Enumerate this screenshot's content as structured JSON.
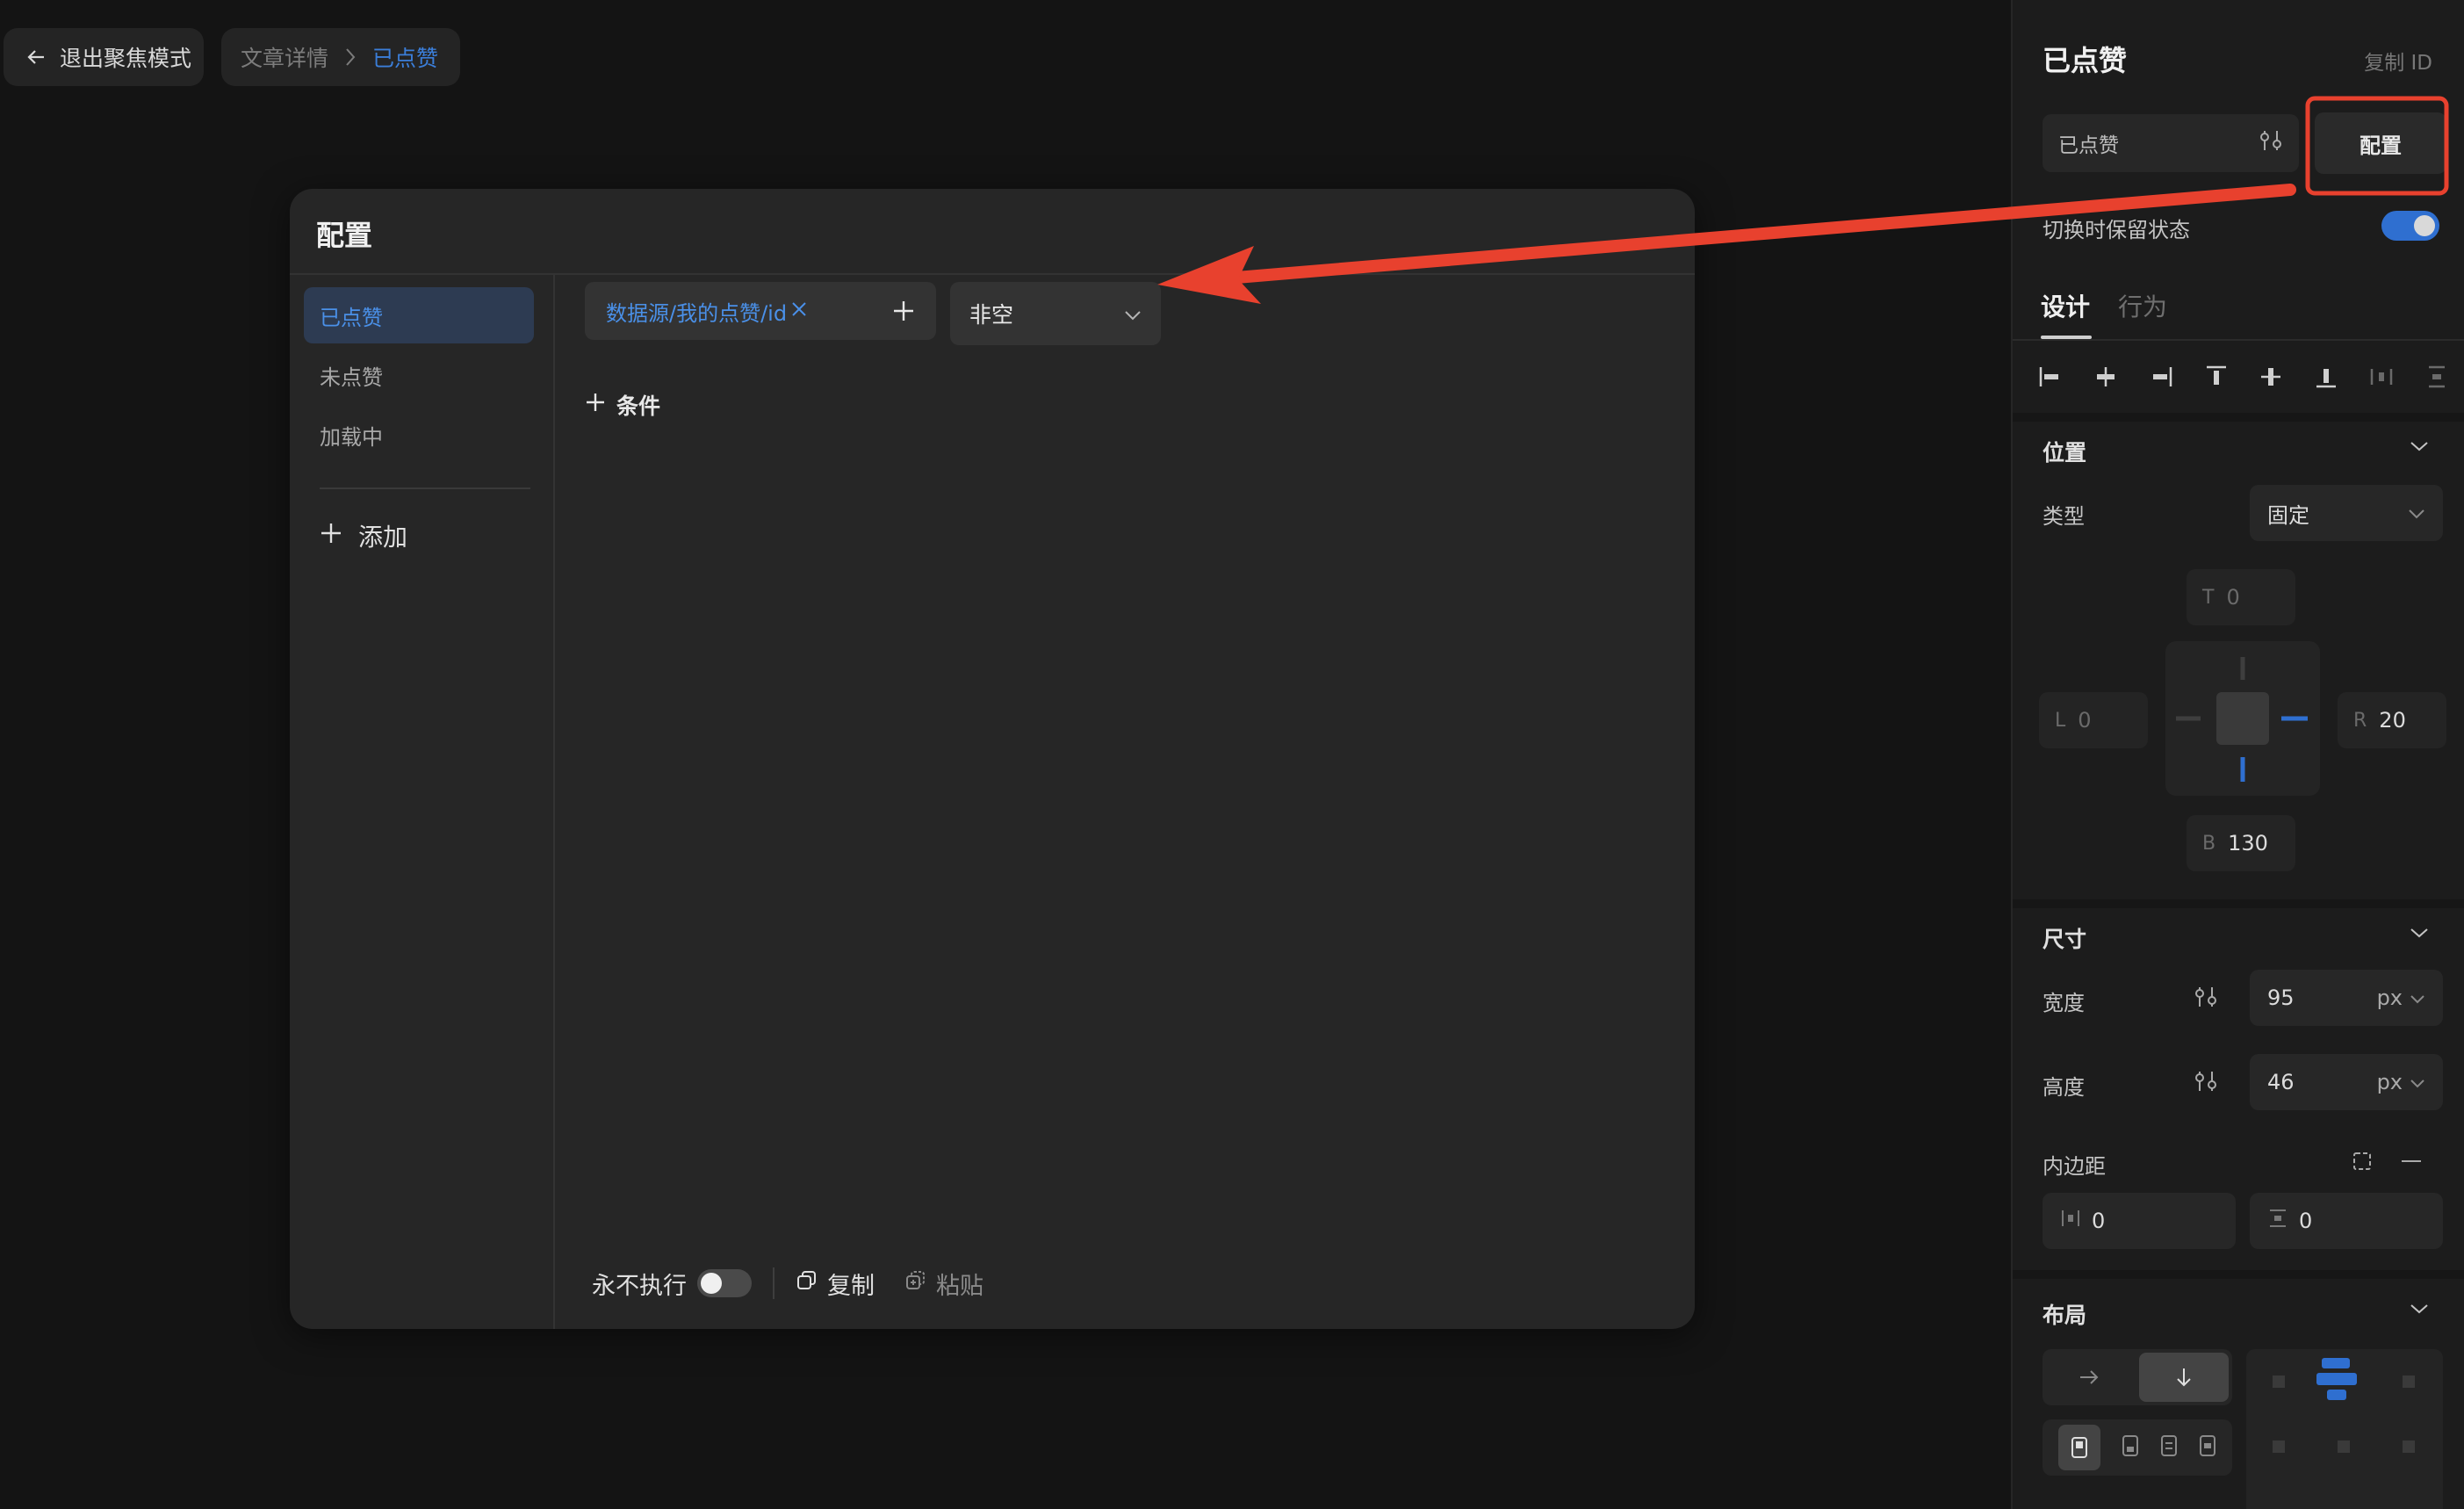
{
  "topbar": {
    "exit_focus_label": "退出聚焦模式",
    "breadcrumb_parent": "文章详情",
    "breadcrumb_current": "已点赞"
  },
  "modal": {
    "title": "配置",
    "states": [
      {
        "label": "已点赞",
        "active": true
      },
      {
        "label": "未点赞",
        "active": false
      },
      {
        "label": "加载中",
        "active": false
      }
    ],
    "add_label": "添加",
    "condition": {
      "field_value": "数据源/我的点赞/id",
      "operator": "非空"
    },
    "add_condition_label": "条件",
    "footer": {
      "never_execute_label": "永不执行",
      "copy_label": "复制",
      "paste_label": "粘贴"
    }
  },
  "panel": {
    "title": "已点赞",
    "copy_id_label": "复制 ID",
    "state_select_value": "已点赞",
    "config_button_label": "配置",
    "keep_state_label": "切换时保留状态",
    "tabs": {
      "design": "设计",
      "behavior": "行为"
    },
    "position": {
      "section_title": "位置",
      "type_label": "类型",
      "type_value": "固定",
      "top": {
        "key": "T",
        "value": "0"
      },
      "left": {
        "key": "L",
        "value": "0"
      },
      "right": {
        "key": "R",
        "value": "20"
      },
      "bottom": {
        "key": "B",
        "value": "130"
      }
    },
    "size": {
      "section_title": "尺寸",
      "width_label": "宽度",
      "width_value": "95",
      "width_unit": "px",
      "height_label": "高度",
      "height_value": "46",
      "height_unit": "px",
      "padding_label": "内边距",
      "padding_h_value": "0",
      "padding_v_value": "0"
    },
    "layout": {
      "section_title": "布局"
    }
  },
  "colors": {
    "accent": "#3b7ed9",
    "annotation_red": "#e8412e",
    "toggle_on": "#2f6fd0"
  }
}
